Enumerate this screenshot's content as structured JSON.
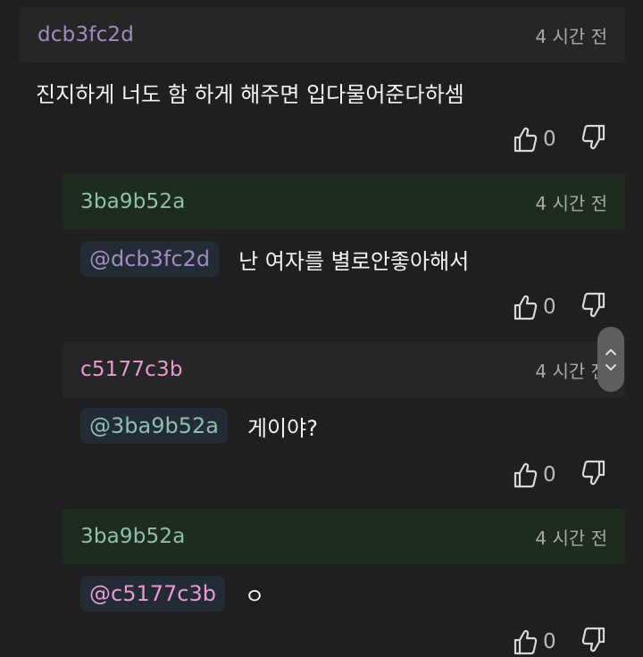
{
  "colors": {
    "background": "#1f1f1f",
    "header_default": "#262626",
    "header_highlight": "#1e2c1e",
    "author_purple": "#a08cc0",
    "author_teal": "#8fbfae",
    "author_pink": "#e59ad0",
    "mention_bg": "#232b36"
  },
  "comments": [
    {
      "author": "dcb3fc2d",
      "time": "4 시간 전",
      "mention": "",
      "text": "진지하게 너도 함 하게 해주면 입다물어준다하셈",
      "likes": "0"
    },
    {
      "author": "3ba9b52a",
      "time": "4 시간 전",
      "mention": "@dcb3fc2d",
      "text": "난 여자를 별로안좋아해서",
      "likes": "0"
    },
    {
      "author": "c5177c3b",
      "time": "4 시간 전",
      "mention": "@3ba9b52a",
      "text": "게이야?",
      "likes": "0"
    },
    {
      "author": "3ba9b52a",
      "time": "4 시간 전",
      "mention": "@c5177c3b",
      "text": "ㅇ",
      "likes": "0"
    }
  ],
  "icons": {
    "like": "thumbs-up-icon",
    "dislike": "thumbs-down-icon",
    "scroll_up": "chevron-up-icon",
    "scroll_down": "chevron-down-icon"
  }
}
